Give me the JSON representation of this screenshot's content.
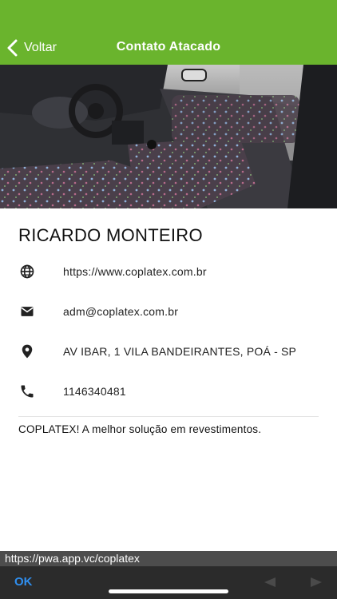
{
  "header": {
    "back_label": "Voltar",
    "title": "Contato Atacado"
  },
  "hero": {
    "image_description": "car-interior-photo"
  },
  "contact": {
    "name": "RICARDO MONTEIRO",
    "website": "https://www.coplatex.com.br",
    "email": "adm@coplatex.com.br",
    "address": "AV IBAR, 1 VILA BANDEIRANTES, POÁ - SP",
    "phone": "1146340481",
    "description": "COPLATEX! A melhor solução em revestimentos."
  },
  "browser": {
    "url": "https://pwa.app.vc/coplatex",
    "ok_label": "OK"
  },
  "colors": {
    "header_bg": "#6ab42d",
    "ok_blue": "#2f8ff0",
    "bottom_bar": "#2b2b2b"
  }
}
